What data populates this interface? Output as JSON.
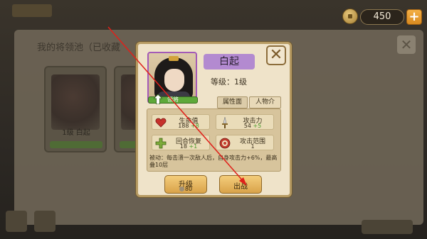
{
  "background": {
    "panel_title": "我的将领池（已收藏",
    "cards": [
      {
        "name": "1级  白起"
      },
      {
        "name": ""
      }
    ]
  },
  "currency": {
    "amount": "450",
    "icon": "coin-icon",
    "add_icon": "plus-icon"
  },
  "dialog": {
    "hero_name": "白起",
    "level_text": "等级：1级",
    "portrait_bar_label": "领将",
    "tabs": [
      {
        "label": "属性面板",
        "active": true
      },
      {
        "label": "人物介绍",
        "active": false
      }
    ],
    "stats": {
      "hp": {
        "label": "生命值",
        "value": "188",
        "bonus": "+8"
      },
      "atk": {
        "label": "攻击力",
        "value": "54",
        "bonus": "+5"
      },
      "regen": {
        "label": "回合恢复",
        "value": "18",
        "bonus": "+1"
      },
      "range": {
        "label": "攻击范围",
        "value": "1"
      }
    },
    "passive": "被动：每击溃一次敌人后，自身攻击力+6%，最高叠10层",
    "buttons": {
      "upgrade": {
        "label": "升级",
        "cost": "80"
      },
      "deploy": {
        "label": "出战"
      }
    },
    "close_icon": "close-icon"
  },
  "colors": {
    "dialog_bg": "#efe3c9",
    "name_tag": "#b38ad0",
    "button": "#e6b65c",
    "accent_plus": "#f4b046",
    "annotation_arrow": "#e0201a"
  }
}
